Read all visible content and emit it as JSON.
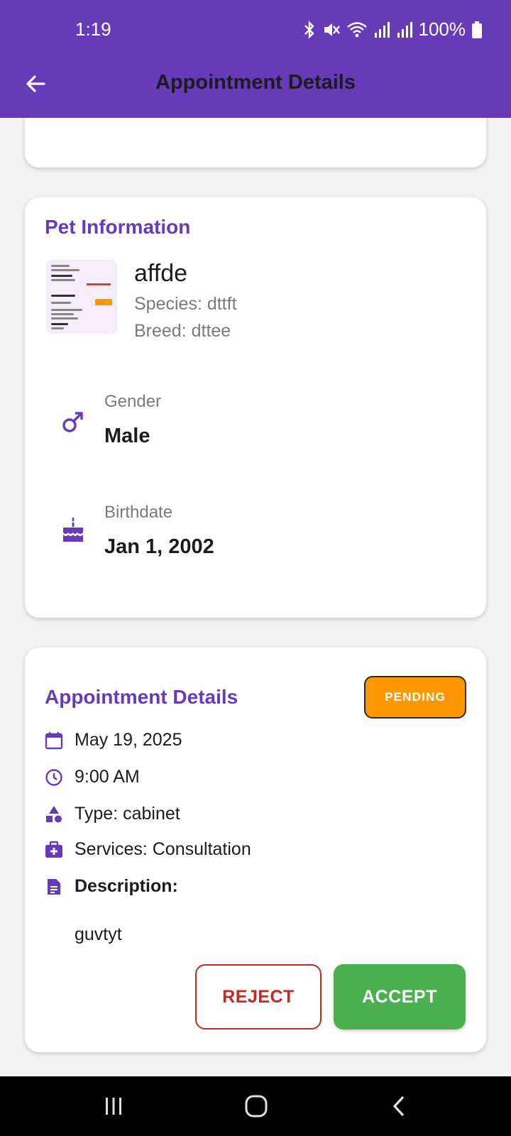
{
  "status_bar": {
    "time": "1:19",
    "battery": "100%"
  },
  "header": {
    "title": "Appointment Details"
  },
  "pet_info": {
    "title": "Pet Information",
    "name": "affde",
    "species": "Species: dttft",
    "breed": "Breed: dttee",
    "gender_label": "Gender",
    "gender_value": "Male",
    "birthdate_label": "Birthdate",
    "birthdate_value": "Jan 1, 2002"
  },
  "appointment": {
    "title": "Appointment Details",
    "status": "PENDING",
    "date": "May 19, 2025",
    "time": "9:00 AM",
    "type": "Type: cabinet",
    "services": "Services: Consultation",
    "description_label": "Description:",
    "description_value": "guvtyt",
    "reject_label": "REJECT",
    "accept_label": "ACCEPT"
  },
  "colors": {
    "primary": "#673ab7",
    "pending": "#ff9800",
    "reject": "#c62828",
    "accept": "#4caf50"
  },
  "icons": [
    "arrow-back-icon",
    "male-icon",
    "cake-icon",
    "calendar-icon",
    "clock-icon",
    "category-icon",
    "medical-bag-icon",
    "document-icon"
  ]
}
